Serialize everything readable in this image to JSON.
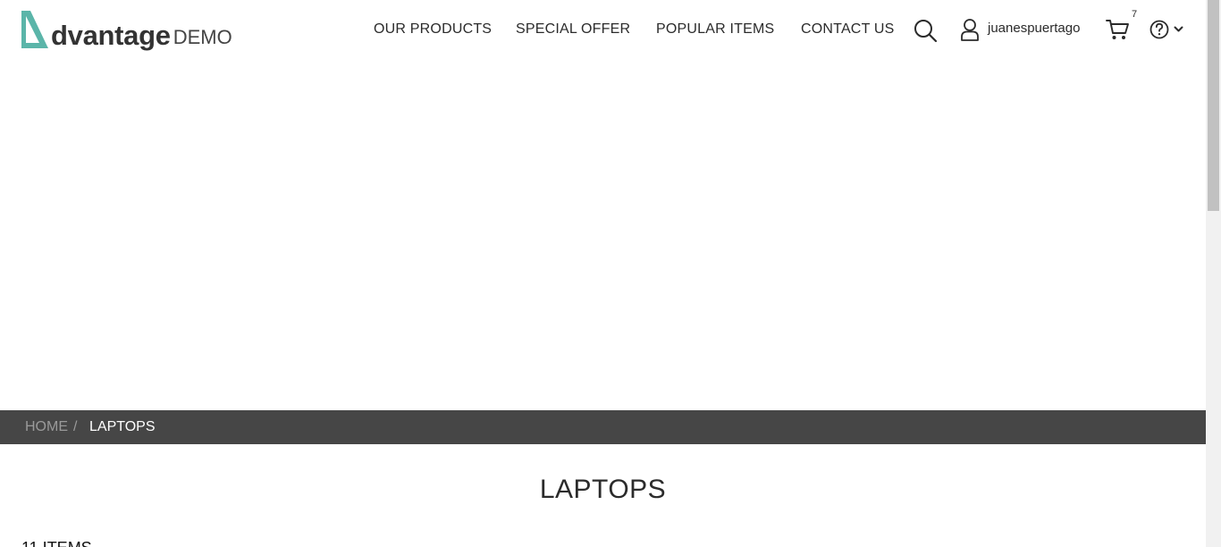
{
  "header": {
    "logo": {
      "word": "dvantage",
      "suffix": "DEMO"
    },
    "nav": [
      {
        "label": "OUR PRODUCTS"
      },
      {
        "label": "SPECIAL OFFER"
      },
      {
        "label": "POPULAR ITEMS"
      },
      {
        "label": "CONTACT US"
      }
    ],
    "search_icon": "search-icon",
    "user": {
      "icon": "user-icon",
      "name": "juanespuertago"
    },
    "cart": {
      "icon": "cart-icon",
      "count": "7"
    },
    "help": {
      "icon": "help-icon",
      "dropdown_icon": "chevron-down-icon"
    }
  },
  "breadcrumb": {
    "home": "HOME",
    "separator": "/",
    "current": "LAPTOPS"
  },
  "main": {
    "title": "LAPTOPS",
    "items_count": "11 ITEMS"
  },
  "colors": {
    "accent": "#5bb5a9",
    "breadcrumb_bg": "#464646",
    "text": "#2b2b2b"
  }
}
